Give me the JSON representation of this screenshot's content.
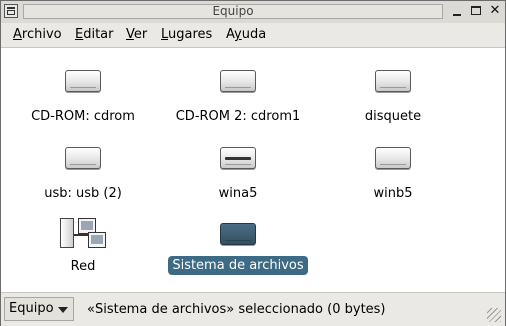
{
  "window": {
    "title": "Equipo"
  },
  "menubar": {
    "items": [
      {
        "label": "Archivo",
        "mnemonic": "A",
        "rest": "rchivo"
      },
      {
        "label": "Editar",
        "mnemonic": "E",
        "rest": "ditar"
      },
      {
        "label": "Ver",
        "mnemonic": "V",
        "rest": "er"
      },
      {
        "label": "Lugares",
        "mnemonic": "L",
        "rest": "ugares"
      },
      {
        "label": "Ayuda",
        "pre": "A",
        "mnemonic": "y",
        "rest": "uda"
      }
    ]
  },
  "icons": [
    {
      "label": "CD-ROM: cdrom",
      "icon": "cdrom-drive-icon"
    },
    {
      "label": "CD-ROM 2: cdrom1",
      "icon": "cdrom-drive-icon"
    },
    {
      "label": "disquete",
      "icon": "floppy-drive-icon"
    },
    {
      "label": "usb: usb (2)",
      "icon": "usb-drive-icon"
    },
    {
      "label": "wina5",
      "icon": "hard-drive-icon"
    },
    {
      "label": "winb5",
      "icon": "hard-drive-icon"
    },
    {
      "label": "Red",
      "icon": "network-icon"
    },
    {
      "label": "Sistema de archivos",
      "icon": "filesystem-drive-icon",
      "selected": true
    }
  ],
  "statusbar": {
    "location": "Equipo",
    "message": "«Sistema de archivos» seleccionado (0 bytes)"
  },
  "colors": {
    "selection": "#3d6a84",
    "selected_drive": "#3d5c70"
  }
}
